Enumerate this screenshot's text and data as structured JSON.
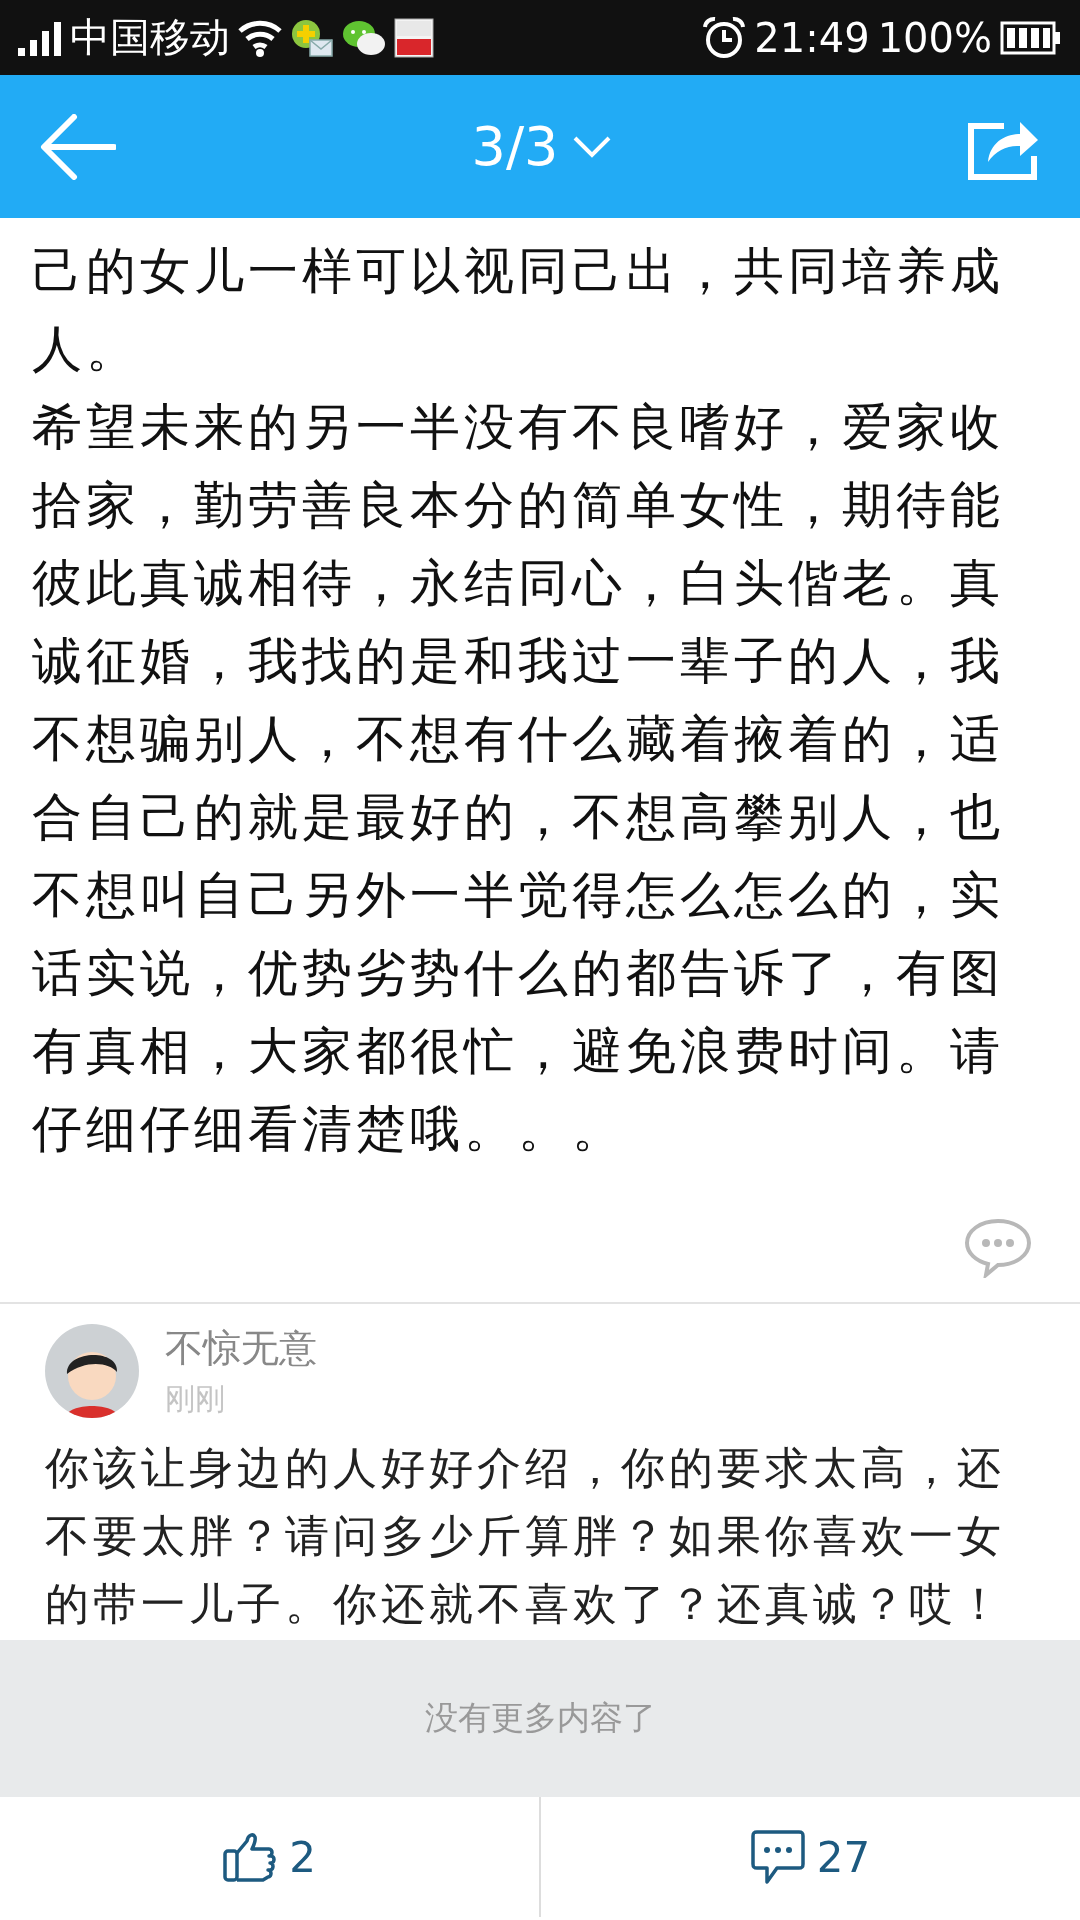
{
  "status_bar": {
    "carrier": "中国移动",
    "time": "21:49",
    "battery": "100%"
  },
  "header": {
    "page": "3/3"
  },
  "article": {
    "paragraphs": [
      "己的女儿一样可以视同己出，共同培养成人。",
      "希望未来的另一半没有不良嗜好，爱家收拾家，勤劳善良本分的简单女性，期待能彼此真诚相待，永结同心，白头偕老。真诚征婚，我找的是和我过一辈子的人，我不想骗别人，不想有什么藏着掖着的，适合自己的就是最好的，不想高攀别人，也不想叫自己另外一半觉得怎么怎么的，实话实说，优势劣势什么的都告诉了，有图有真相，大家都很忙，避免浪费时间。请仔细仔细看清楚哦。。。"
    ]
  },
  "comment": {
    "author": "不惊无意",
    "time": "刚刚",
    "text": "你该让身边的人好好介绍，你的要求太高，还不要太胖？请问多少斤算胖？如果你喜欢一女的带一儿子。你还就不喜欢了？还真诚？哎！"
  },
  "end_notice": "没有更多内容了",
  "actions": {
    "likes": "2",
    "comments": "27"
  }
}
